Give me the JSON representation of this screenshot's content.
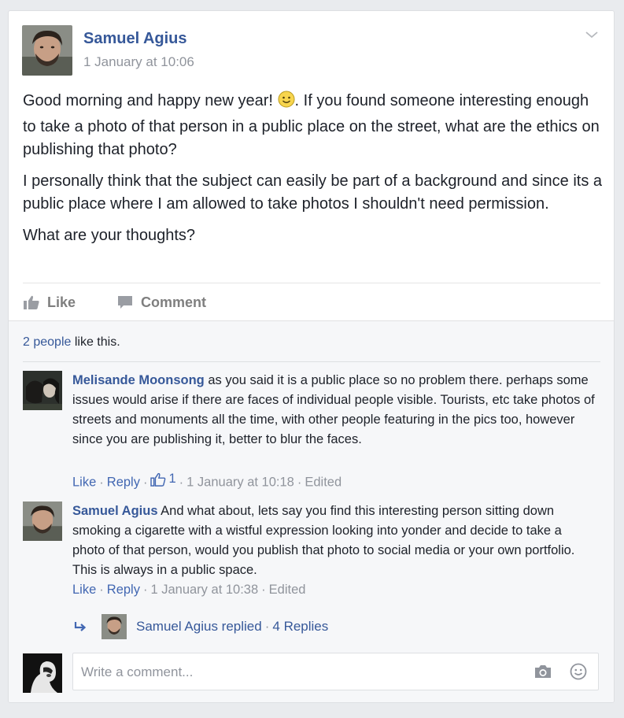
{
  "post": {
    "author": "Samuel Agius",
    "timestamp": "1 January at 10:06",
    "paragraph1_a": "Good morning and happy new year! ",
    "paragraph1_b": ". If you found someone interesting enough to take a photo of that person in a public place on the street, what are the ethics on publishing that photo?",
    "paragraph2": "I personally think that the subject can easily be part of a background and since its a public place where I am allowed to take photos I shouldn't need permission.",
    "paragraph3": "What are your thoughts?"
  },
  "actions": {
    "like_label": "Like",
    "comment_label": "Comment"
  },
  "likes": {
    "count_link": "2 people",
    "suffix": " like this."
  },
  "comments": [
    {
      "author": "Melisande Moonsong",
      "text": " as you said it is a public place so no problem there. perhaps some issues would arise if there are faces of individual people visible. Tourists, etc take photos of streets and monuments all the time, with other people featuring in the pics too, however since you are publishing it, better to blur the faces.",
      "like_label": "Like",
      "reply_label": "Reply",
      "like_count": "1",
      "time": "1 January at 10:18",
      "edited": "Edited"
    },
    {
      "author": "Samuel Agius",
      "text": " And what about, lets say you find this interesting person sitting down smoking a cigarette with a wistful expression looking into yonder and decide to take a photo of that person, would you publish that photo to social media or your own portfolio. This is always in a public space.",
      "like_label": "Like",
      "reply_label": "Reply",
      "time": "1 January at 10:38",
      "edited": "Edited"
    }
  ],
  "replies": {
    "text": "Samuel Agius replied",
    "count": "4 Replies"
  },
  "composer": {
    "placeholder": "Write a comment..."
  },
  "colors": {
    "link": "#365899",
    "meta": "#90949c",
    "background": "#e9ebee",
    "comments_bg": "#f6f7f9"
  },
  "icons": [
    "chevron-down-icon",
    "smiley-icon",
    "thumbs-up-icon",
    "comment-bubble-icon",
    "reply-arrow-icon",
    "camera-icon",
    "emoji-icon"
  ]
}
